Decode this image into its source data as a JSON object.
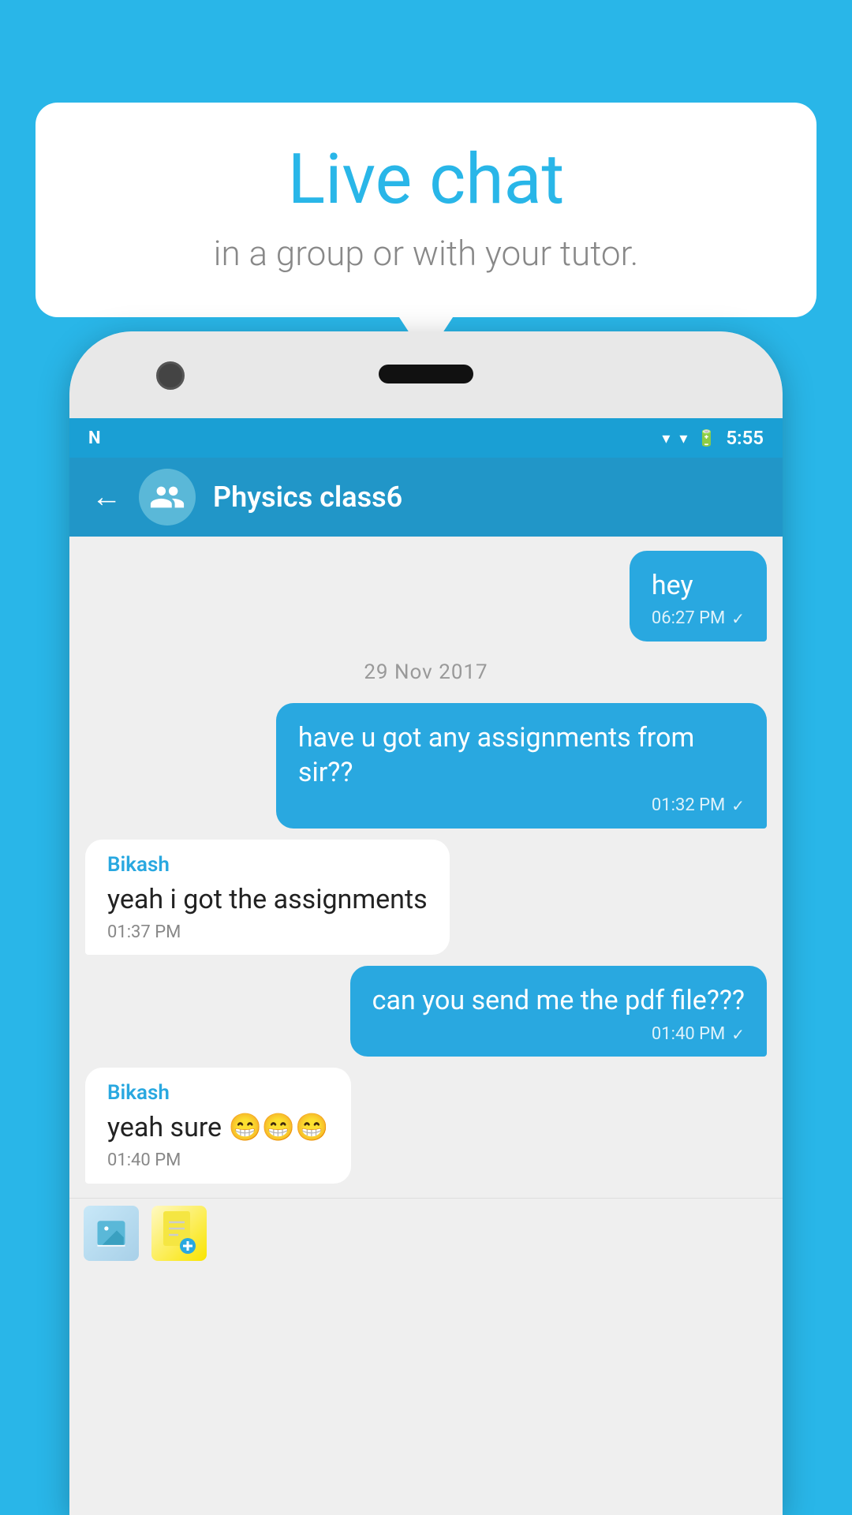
{
  "background_color": "#29b6e8",
  "speech_bubble": {
    "title": "Live chat",
    "subtitle": "in a group or with your tutor."
  },
  "phone": {
    "status_bar": {
      "time": "5:55",
      "wifi": "▼",
      "battery": "⚡"
    },
    "app_bar": {
      "back": "←",
      "title": "Physics class6"
    },
    "messages": [
      {
        "type": "sent",
        "text": "hey",
        "time": "06:27 PM",
        "check": "✓"
      },
      {
        "type": "date_divider",
        "text": "29  Nov  2017"
      },
      {
        "type": "sent",
        "text": "have u got any assignments from sir??",
        "time": "01:32 PM",
        "check": "✓"
      },
      {
        "type": "received",
        "sender": "Bikash",
        "text": "yeah i got the assignments",
        "time": "01:37 PM"
      },
      {
        "type": "sent",
        "text": "can you send me the pdf file???",
        "time": "01:40 PM",
        "check": "✓"
      },
      {
        "type": "received",
        "sender": "Bikash",
        "text": "yeah sure 😁😁😁",
        "time": "01:40 PM"
      }
    ],
    "toolbar": {
      "image_icon": "🖼",
      "doc_icon": "📄"
    }
  }
}
